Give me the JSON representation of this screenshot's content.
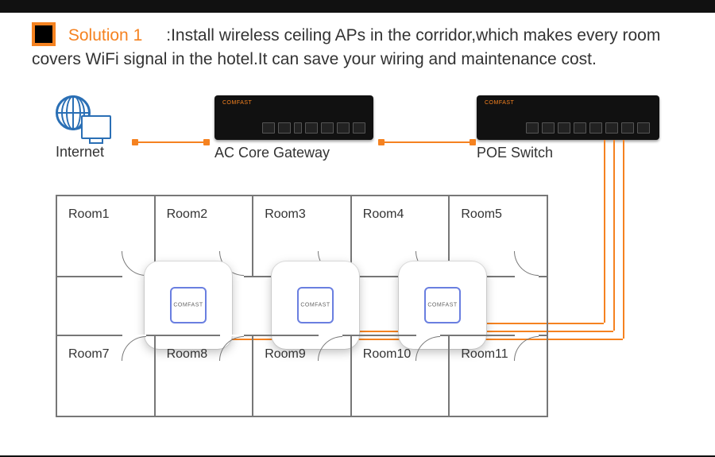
{
  "heading": {
    "title": "Solution 1",
    "body": ":Install wireless ceiling APs in the corridor,which makes every room covers WiFi signal in the hotel.It can save your wiring and maintenance cost."
  },
  "nodes": {
    "internet": "Internet",
    "gateway": "AC Core Gateway",
    "poe": "POE Switch"
  },
  "device_brand": "COMFAST",
  "ap_brand": "COMFAST",
  "rooms_top": [
    "Room1",
    "Room2",
    "Room3",
    "Room4",
    "Room5"
  ],
  "rooms_bottom": [
    "Room7",
    "Room8",
    "Room9",
    "Room10",
    "Room11"
  ]
}
